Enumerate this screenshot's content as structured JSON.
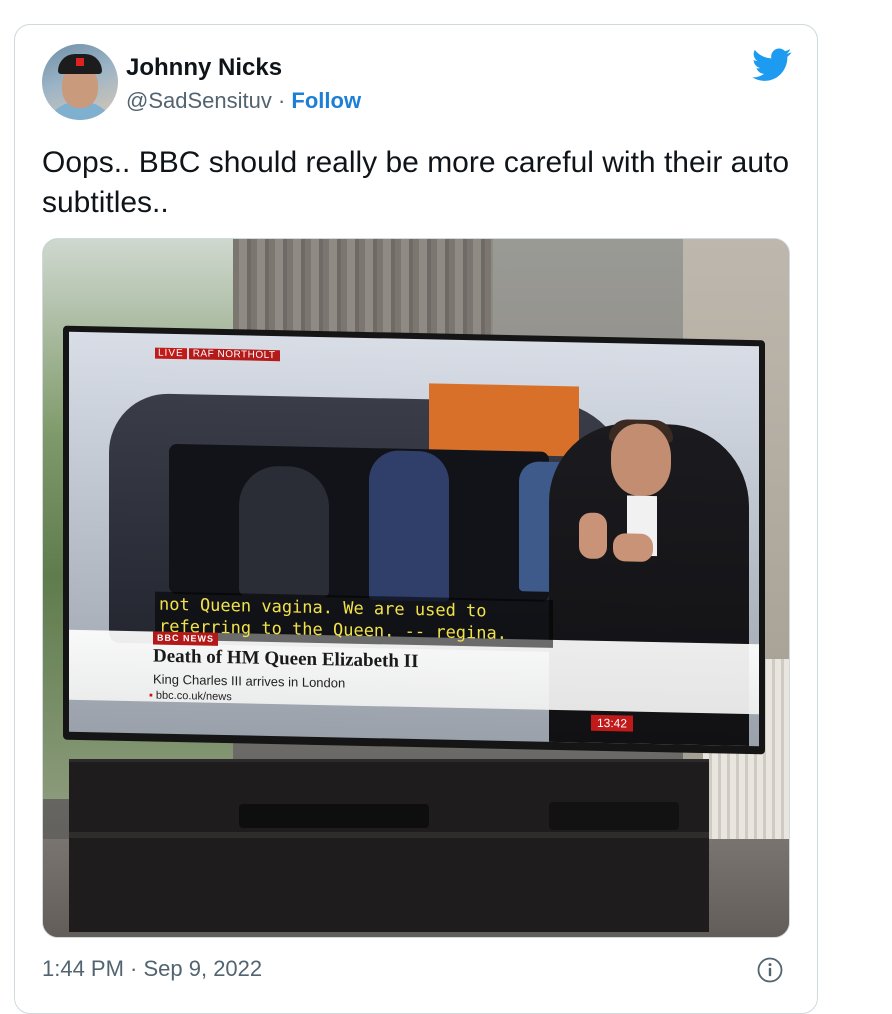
{
  "author": {
    "name": "Johnny Nicks",
    "handle": "@SadSensituv",
    "separator": " · ",
    "follow_label": "Follow"
  },
  "tweet": {
    "text": "Oops.. BBC should really be more careful with their auto subtitles.."
  },
  "media": {
    "live_badge": "LIVE",
    "location": "RAF NORTHOLT",
    "subtitle_line1": "not Queen vagina. We are used to",
    "subtitle_line2": "referring to the Queen. -- regina.",
    "news_badge": "BBC NEWS",
    "headline": "Death of HM Queen Elizabeth II",
    "subheadline": "King Charles III arrives in London",
    "url": "bbc.co.uk/news",
    "clock": "13:42"
  },
  "footer": {
    "timestamp": "1:44 PM · Sep 9, 2022"
  },
  "icons": {
    "brand": "twitter-bird-icon",
    "info": "info-icon"
  },
  "colors": {
    "follow_blue": "#1d7fd6",
    "twitter_blue": "#1d9bf0",
    "secondary_text": "#536471",
    "bbc_red": "#c11a1a"
  }
}
